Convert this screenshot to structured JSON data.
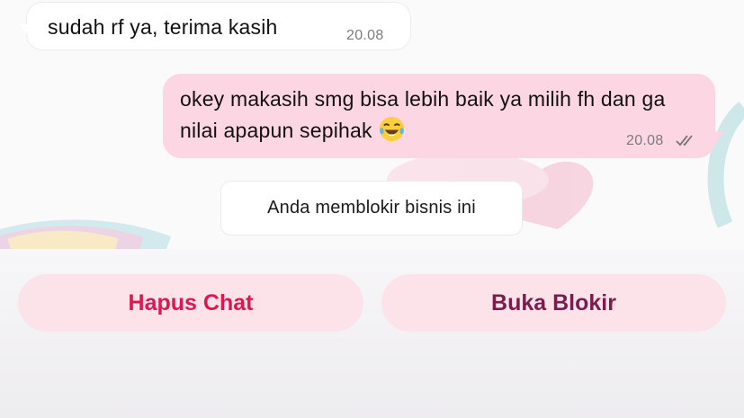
{
  "colors": {
    "incoming_bubble": "#ffffff",
    "outgoing_bubble": "#fdd6e3",
    "button_background": "#fce3ea",
    "delete_text": "#dc1850",
    "unblock_text": "#7a1d4c"
  },
  "messages": [
    {
      "direction": "incoming",
      "text": "sudah rf ya, terima kasih",
      "time": "20.08"
    },
    {
      "direction": "outgoing",
      "text": "okey makasih smg bisa lebih baik ya milih fh dan ga nilai apapun sepihak",
      "emoji": "😂",
      "emoji_icon": "face-with-tears-of-joy-icon",
      "time": "20.08",
      "status_icon": "double-check-icon"
    }
  ],
  "system_notice": "Anda memblokir bisnis ini",
  "actions": {
    "delete_chat_label": "Hapus Chat",
    "unblock_label": "Buka Blokir"
  }
}
